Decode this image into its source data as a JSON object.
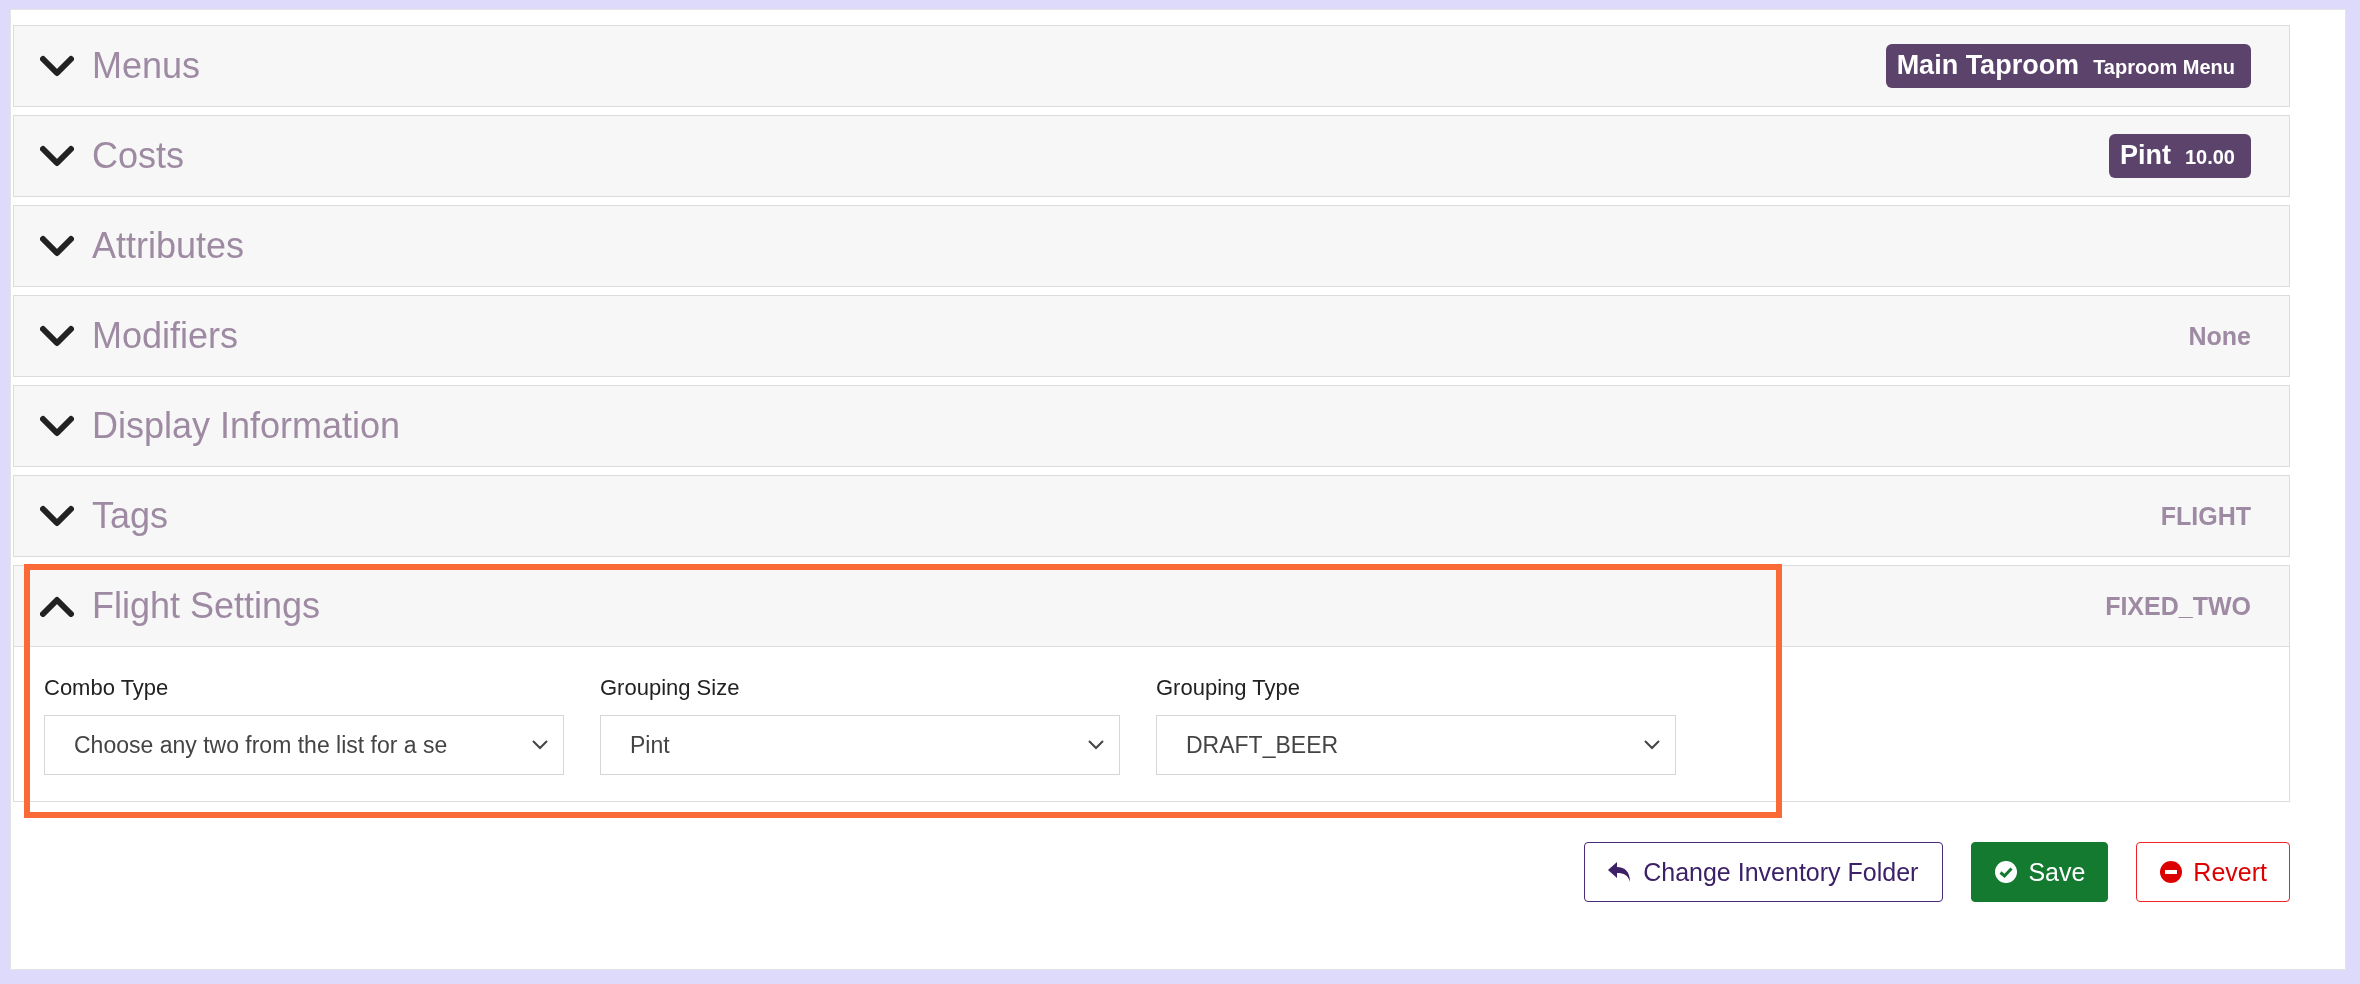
{
  "sections": [
    {
      "title": "Menus",
      "expanded": false,
      "summary": {
        "kind": "badge",
        "primary": "Main Taproom",
        "secondary": "Taproom Menu"
      }
    },
    {
      "title": "Costs",
      "expanded": false,
      "summary": {
        "kind": "badge",
        "primary": "Pint",
        "secondary": "10.00"
      }
    },
    {
      "title": "Attributes",
      "expanded": false
    },
    {
      "title": "Modifiers",
      "expanded": false,
      "summary": {
        "kind": "text",
        "text": "None"
      }
    },
    {
      "title": "Display Information",
      "expanded": false
    },
    {
      "title": "Tags",
      "expanded": false,
      "summary": {
        "kind": "text",
        "text": "FLIGHT"
      }
    },
    {
      "title": "Flight Settings",
      "expanded": true,
      "highlighted": true,
      "summary": {
        "kind": "text",
        "text": "FIXED_TWO"
      },
      "fields": [
        {
          "label": "Combo Type",
          "value": "Choose any two from the list for a se"
        },
        {
          "label": "Grouping Size",
          "value": "Pint"
        },
        {
          "label": "Grouping Type",
          "value": "DRAFT_BEER"
        }
      ]
    }
  ],
  "buttons": [
    {
      "kind": "folder",
      "label": "Change Inventory Folder"
    },
    {
      "kind": "save",
      "label": "Save"
    },
    {
      "kind": "revert",
      "label": "Revert"
    }
  ]
}
